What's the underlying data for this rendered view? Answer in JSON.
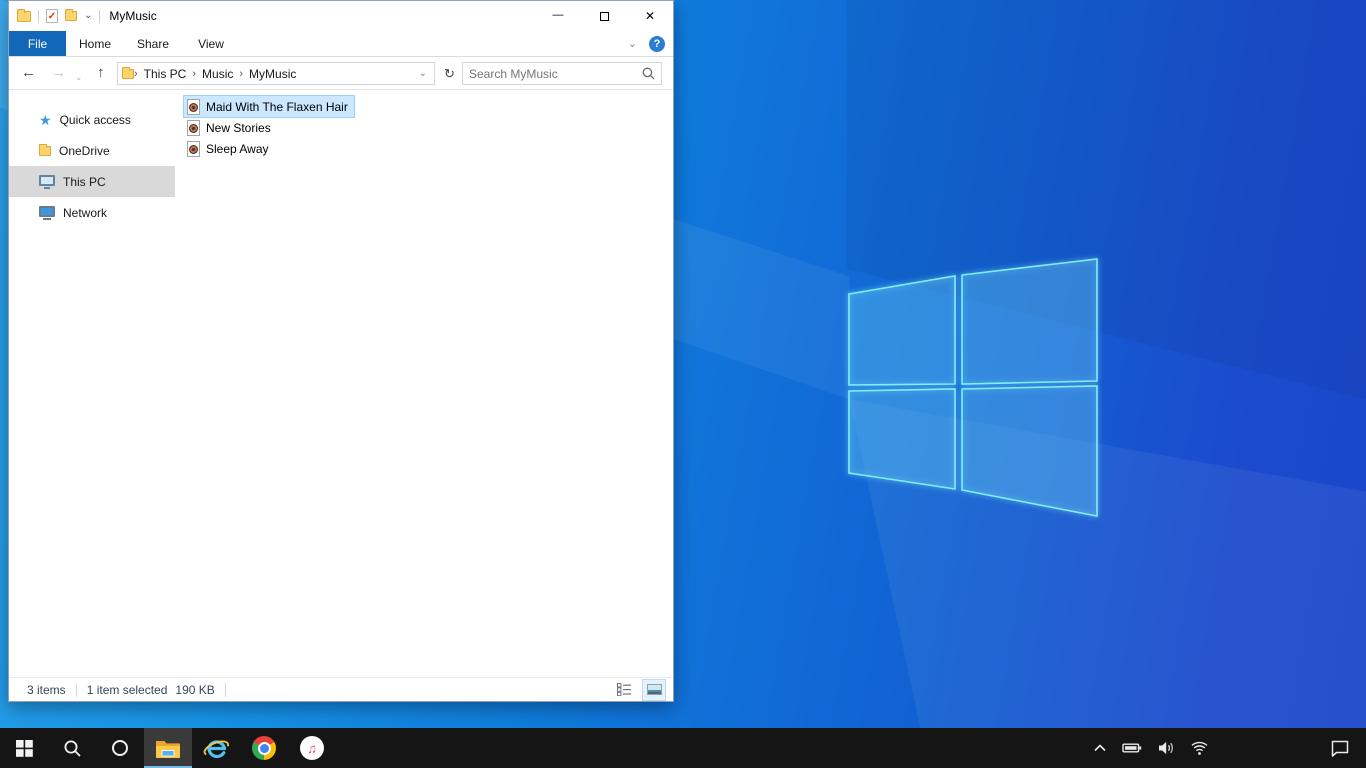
{
  "colors": {
    "file_tab_bg": "#1267b8",
    "selection_fill": "#cce8ff",
    "selection_border": "#99d1ff",
    "sidebar_selected_bg": "#d9d9d9",
    "taskbar_bg": "#151515",
    "taskbar_active_underline": "#76b9ed",
    "desktop_left": "#2aa1ea",
    "desktop_right": "#1a46c8",
    "logo_stroke": "#7ef0f6",
    "help_button_bg": "#2d7dd2"
  },
  "glyphs": {
    "back": "←",
    "forward": "→",
    "up": "↑",
    "chevron_down": "⌄",
    "refresh": "↻",
    "crumb_separator": "›",
    "minimize": "—",
    "close": "✕",
    "help": "?",
    "quick_access_star": "★",
    "music_note": "♫",
    "properties_check": "✓"
  },
  "window": {
    "title": "MyMusic",
    "tabs": [
      {
        "label": "File",
        "active": true
      },
      {
        "label": "Home",
        "active": false
      },
      {
        "label": "Share",
        "active": false
      },
      {
        "label": "View",
        "active": false
      }
    ],
    "breadcrumb": {
      "segments": [
        "This PC",
        "Music",
        "MyMusic"
      ]
    },
    "search": {
      "placeholder": "Search MyMusic"
    },
    "sidebar": [
      {
        "label": "Quick access",
        "selected": false
      },
      {
        "label": "OneDrive",
        "selected": false
      },
      {
        "label": "This PC",
        "selected": true
      },
      {
        "label": "Network",
        "selected": false
      }
    ],
    "files": [
      {
        "name": "Maid With The Flaxen Hair",
        "selected": true
      },
      {
        "name": "New Stories",
        "selected": false
      },
      {
        "name": "Sleep Away",
        "selected": false
      }
    ],
    "status": {
      "count": "3 items",
      "selected": "1 item selected",
      "size": "190 KB"
    }
  }
}
